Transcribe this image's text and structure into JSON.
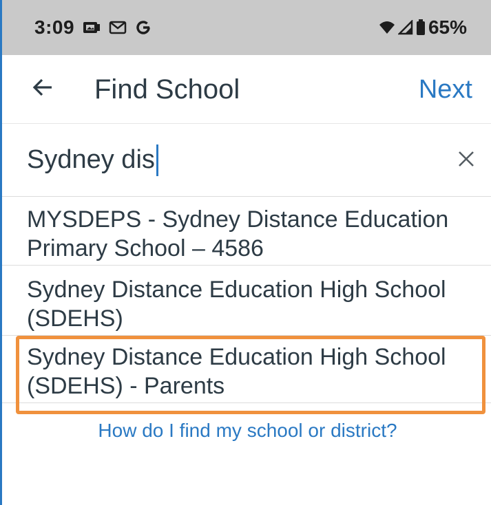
{
  "status_bar": {
    "time": "3:09",
    "left_icons": [
      "photo-icon",
      "gmail-icon",
      "google-icon"
    ],
    "battery_percent": "65%",
    "right_icons": [
      "wifi-icon",
      "signal-icon",
      "battery-icon"
    ]
  },
  "header": {
    "title": "Find School",
    "next_label": "Next"
  },
  "search": {
    "value": "Sydney dis",
    "clear_icon": "close-icon"
  },
  "results": [
    {
      "line1": "MYSDEPS - Sydney Distance Education",
      "line2": "Primary School – 4586"
    },
    {
      "line1": "Sydney Distance Education High School",
      "line2": "(SDEHS)"
    },
    {
      "line1": "Sydney Distance Education High School",
      "line2": "(SDEHS) - Parents"
    }
  ],
  "help_link": "How do I find my school or district?",
  "colors": {
    "accent": "#2a79c3",
    "highlight": "#f0913d",
    "status_bar": "#c9c9c9",
    "text": "#2d3b45"
  }
}
